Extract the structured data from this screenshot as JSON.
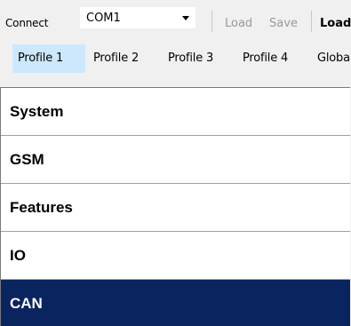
{
  "toolbar": {
    "connect_label": "Connect",
    "port_value": "COM1",
    "load_label": "Load",
    "save_label": "Save",
    "load_from_device_label": "Load"
  },
  "tabs": [
    {
      "label": "Profile 1",
      "active": true
    },
    {
      "label": "Profile 2",
      "active": false
    },
    {
      "label": "Profile 3",
      "active": false
    },
    {
      "label": "Profile 4",
      "active": false
    },
    {
      "label": "Globa",
      "active": false
    }
  ],
  "sections": [
    {
      "label": "System",
      "selected": false
    },
    {
      "label": "GSM",
      "selected": false
    },
    {
      "label": "Features",
      "selected": false
    },
    {
      "label": "IO",
      "selected": false
    },
    {
      "label": "CAN",
      "selected": true
    }
  ],
  "colors": {
    "selected_bg": "#0a2460",
    "active_tab_bg": "#cde8fc"
  }
}
